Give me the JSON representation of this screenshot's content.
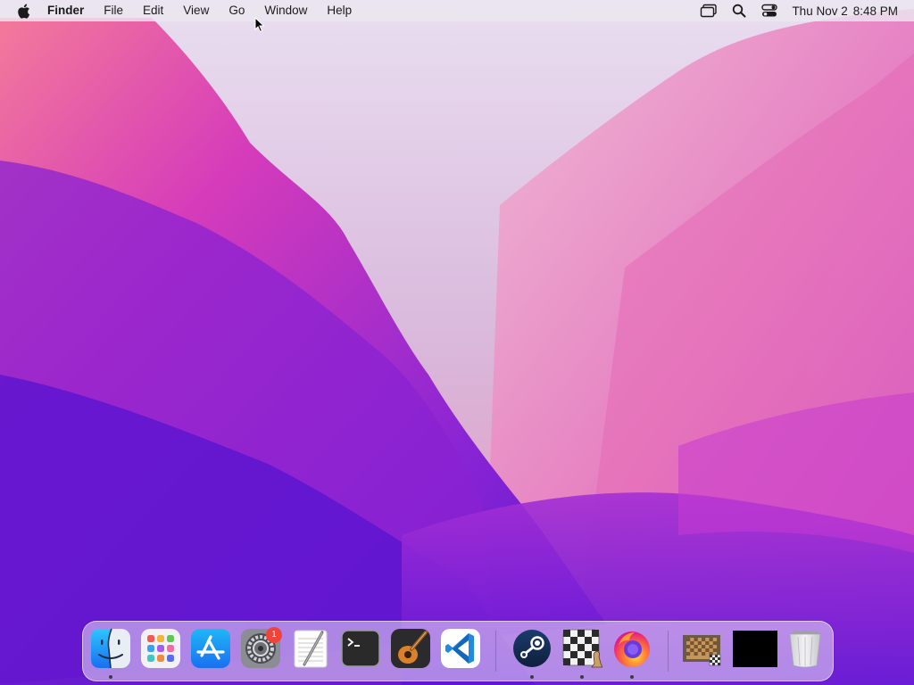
{
  "menubar": {
    "app_name": "Finder",
    "menus": [
      "File",
      "Edit",
      "View",
      "Go",
      "Window",
      "Help"
    ],
    "status_icons": [
      "screen-mirroring-icon",
      "spotlight-search-icon",
      "control-center-icon"
    ],
    "clock": {
      "date": "Thu Nov 2",
      "time": "8:48 PM"
    }
  },
  "dock": {
    "apps": [
      {
        "name": "Finder",
        "icon": "finder-icon",
        "running": true
      },
      {
        "name": "Launchpad",
        "icon": "launchpad-icon",
        "running": false
      },
      {
        "name": "App Store",
        "icon": "app-store-icon",
        "running": false
      },
      {
        "name": "System Preferences",
        "icon": "system-preferences-icon",
        "running": false,
        "badge": "1"
      },
      {
        "name": "TextEdit",
        "icon": "textedit-icon",
        "running": false
      },
      {
        "name": "Terminal",
        "icon": "terminal-icon",
        "running": false
      },
      {
        "name": "GarageBand",
        "icon": "garageband-icon",
        "running": false
      },
      {
        "name": "Visual Studio Code",
        "icon": "vscode-icon",
        "running": false
      },
      {
        "name": "Steam",
        "icon": "steam-icon",
        "running": true
      },
      {
        "name": "Chess",
        "icon": "chess-icon",
        "running": true
      },
      {
        "name": "Firefox",
        "icon": "firefox-icon",
        "running": true
      }
    ],
    "minimized": [
      {
        "name": "Chess window",
        "icon": "chess-window-thumbnail-icon"
      },
      {
        "name": "Black window",
        "icon": "black-window-thumbnail-icon"
      }
    ],
    "trash": {
      "name": "Trash",
      "icon": "trash-icon"
    }
  },
  "colors": {
    "badge": "#f0443a",
    "menubar_bg": "#ece6f0",
    "wallpaper_primary": "#6a1fd6",
    "wallpaper_accent": "#e04bb8"
  }
}
